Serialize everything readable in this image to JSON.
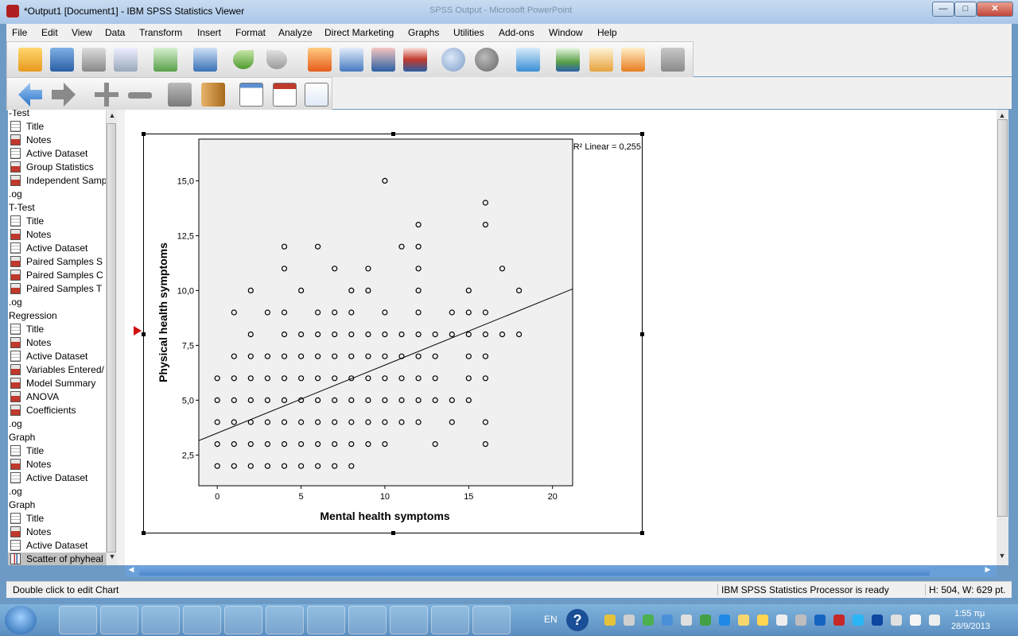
{
  "window": {
    "title": "*Output1 [Document1] - IBM SPSS Statistics Viewer",
    "background_title": "SPSS Output - Microsoft PowerPoint",
    "minimize": "—",
    "maximize": "□",
    "close": "✕"
  },
  "menu": [
    "File",
    "Edit",
    "View",
    "Data",
    "Transform",
    "Insert",
    "Format",
    "Analyze",
    "Direct Marketing",
    "Graphs",
    "Utilities",
    "Add-ons",
    "Window",
    "Help"
  ],
  "toolbar1": [
    "open-icon",
    "save-icon",
    "print-icon",
    "print-preview-icon",
    "export-icon",
    "recall-dialog-icon",
    "undo-icon",
    "redo-icon",
    "goto-data-icon",
    "goto-case-icon",
    "goto-variable-icon",
    "variables-icon",
    "spelling-icon",
    "designate-window-icon",
    "create-edit-icon",
    "show-all-variables-icon",
    "use-variable-sets-icon",
    "insert-output-icon",
    "run-script-icon",
    "disabled-icon"
  ],
  "toolbar2": [
    "back-arrow-icon",
    "forward-arrow-icon",
    "expand-icon",
    "collapse-icon",
    "show-icon",
    "hide-icon",
    "insert-heading-icon",
    "insert-title-icon",
    "insert-text-icon"
  ],
  "outline": [
    {
      "label": "-Test",
      "type": "heading"
    },
    {
      "label": "Title",
      "type": "item",
      "icon": "doc"
    },
    {
      "label": "Notes",
      "type": "item",
      "icon": "red"
    },
    {
      "label": "Active Dataset",
      "type": "item",
      "icon": "doc"
    },
    {
      "label": "Group Statistics",
      "type": "item",
      "icon": "red"
    },
    {
      "label": "Independent Samp",
      "type": "item",
      "icon": "red"
    },
    {
      "label": ".og",
      "type": "heading"
    },
    {
      "label": "T-Test",
      "type": "heading"
    },
    {
      "label": "Title",
      "type": "item",
      "icon": "doc"
    },
    {
      "label": "Notes",
      "type": "item",
      "icon": "red"
    },
    {
      "label": "Active Dataset",
      "type": "item",
      "icon": "doc"
    },
    {
      "label": "Paired Samples S",
      "type": "item",
      "icon": "red"
    },
    {
      "label": "Paired Samples C",
      "type": "item",
      "icon": "red"
    },
    {
      "label": "Paired Samples T",
      "type": "item",
      "icon": "red"
    },
    {
      "label": ".og",
      "type": "heading"
    },
    {
      "label": "Regression",
      "type": "heading"
    },
    {
      "label": "Title",
      "type": "item",
      "icon": "doc"
    },
    {
      "label": "Notes",
      "type": "item",
      "icon": "red"
    },
    {
      "label": "Active Dataset",
      "type": "item",
      "icon": "doc"
    },
    {
      "label": "Variables Entered/",
      "type": "item",
      "icon": "red"
    },
    {
      "label": "Model Summary",
      "type": "item",
      "icon": "red"
    },
    {
      "label": "ANOVA",
      "type": "item",
      "icon": "red"
    },
    {
      "label": "Coefficients",
      "type": "item",
      "icon": "red"
    },
    {
      "label": ".og",
      "type": "heading"
    },
    {
      "label": "Graph",
      "type": "heading"
    },
    {
      "label": "Title",
      "type": "item",
      "icon": "doc"
    },
    {
      "label": "Notes",
      "type": "item",
      "icon": "red"
    },
    {
      "label": "Active Dataset",
      "type": "item",
      "icon": "doc"
    },
    {
      "label": ".og",
      "type": "heading"
    },
    {
      "label": "Graph",
      "type": "heading"
    },
    {
      "label": "Title",
      "type": "item",
      "icon": "doc"
    },
    {
      "label": "Notes",
      "type": "item",
      "icon": "red"
    },
    {
      "label": "Active Dataset",
      "type": "item",
      "icon": "doc"
    },
    {
      "label": "Scatter of phyheal",
      "type": "item",
      "icon": "chart",
      "selected": true
    }
  ],
  "chart_data": {
    "type": "scatter",
    "xlabel": "Mental health symptoms",
    "ylabel": "Physical health symptoms",
    "xlim": [
      -1.1,
      21.2
    ],
    "ylim": [
      1.1,
      16.9
    ],
    "xticks": [
      0,
      5,
      10,
      15,
      20
    ],
    "xtick_labels": [
      "0",
      "5",
      "10",
      "15",
      "20"
    ],
    "yticks": [
      2.5,
      5.0,
      7.5,
      10.0,
      12.5,
      15.0
    ],
    "ytick_labels": [
      "2,5",
      "5,0",
      "7,5",
      "10,0",
      "12,5",
      "15,0"
    ],
    "r2_label": "R² Linear = 0,255",
    "fit_line": {
      "intercept": 3.5,
      "slope": 0.31
    },
    "points": [
      [
        0,
        2
      ],
      [
        1,
        2
      ],
      [
        2,
        2
      ],
      [
        3,
        2
      ],
      [
        4,
        2
      ],
      [
        5,
        2
      ],
      [
        6,
        2
      ],
      [
        7,
        2
      ],
      [
        8,
        2
      ],
      [
        0,
        3
      ],
      [
        1,
        3
      ],
      [
        2,
        3
      ],
      [
        3,
        3
      ],
      [
        4,
        3
      ],
      [
        5,
        3
      ],
      [
        6,
        3
      ],
      [
        7,
        3
      ],
      [
        8,
        3
      ],
      [
        9,
        3
      ],
      [
        10,
        3
      ],
      [
        13,
        3
      ],
      [
        16,
        3
      ],
      [
        0,
        4
      ],
      [
        1,
        4
      ],
      [
        2,
        4
      ],
      [
        3,
        4
      ],
      [
        4,
        4
      ],
      [
        5,
        4
      ],
      [
        6,
        4
      ],
      [
        7,
        4
      ],
      [
        8,
        4
      ],
      [
        9,
        4
      ],
      [
        10,
        4
      ],
      [
        11,
        4
      ],
      [
        12,
        4
      ],
      [
        14,
        4
      ],
      [
        16,
        4
      ],
      [
        0,
        5
      ],
      [
        1,
        5
      ],
      [
        2,
        5
      ],
      [
        3,
        5
      ],
      [
        4,
        5
      ],
      [
        5,
        5
      ],
      [
        6,
        5
      ],
      [
        7,
        5
      ],
      [
        8,
        5
      ],
      [
        9,
        5
      ],
      [
        10,
        5
      ],
      [
        11,
        5
      ],
      [
        12,
        5
      ],
      [
        13,
        5
      ],
      [
        14,
        5
      ],
      [
        15,
        5
      ],
      [
        0,
        6
      ],
      [
        1,
        6
      ],
      [
        2,
        6
      ],
      [
        3,
        6
      ],
      [
        4,
        6
      ],
      [
        5,
        6
      ],
      [
        6,
        6
      ],
      [
        7,
        6
      ],
      [
        8,
        6
      ],
      [
        9,
        6
      ],
      [
        10,
        6
      ],
      [
        11,
        6
      ],
      [
        12,
        6
      ],
      [
        13,
        6
      ],
      [
        15,
        6
      ],
      [
        16,
        6
      ],
      [
        1,
        7
      ],
      [
        2,
        7
      ],
      [
        3,
        7
      ],
      [
        4,
        7
      ],
      [
        5,
        7
      ],
      [
        6,
        7
      ],
      [
        7,
        7
      ],
      [
        8,
        7
      ],
      [
        9,
        7
      ],
      [
        10,
        7
      ],
      [
        11,
        7
      ],
      [
        12,
        7
      ],
      [
        13,
        7
      ],
      [
        15,
        7
      ],
      [
        16,
        7
      ],
      [
        2,
        8
      ],
      [
        4,
        8
      ],
      [
        5,
        8
      ],
      [
        6,
        8
      ],
      [
        7,
        8
      ],
      [
        8,
        8
      ],
      [
        9,
        8
      ],
      [
        10,
        8
      ],
      [
        11,
        8
      ],
      [
        12,
        8
      ],
      [
        13,
        8
      ],
      [
        14,
        8
      ],
      [
        15,
        8
      ],
      [
        16,
        8
      ],
      [
        17,
        8
      ],
      [
        18,
        8
      ],
      [
        1,
        9
      ],
      [
        3,
        9
      ],
      [
        4,
        9
      ],
      [
        6,
        9
      ],
      [
        7,
        9
      ],
      [
        8,
        9
      ],
      [
        10,
        9
      ],
      [
        12,
        9
      ],
      [
        14,
        9
      ],
      [
        15,
        9
      ],
      [
        16,
        9
      ],
      [
        2,
        10
      ],
      [
        5,
        10
      ],
      [
        8,
        10
      ],
      [
        9,
        10
      ],
      [
        12,
        10
      ],
      [
        15,
        10
      ],
      [
        18,
        10
      ],
      [
        4,
        11
      ],
      [
        7,
        11
      ],
      [
        9,
        11
      ],
      [
        12,
        11
      ],
      [
        17,
        11
      ],
      [
        4,
        12
      ],
      [
        6,
        12
      ],
      [
        11,
        12
      ],
      [
        12,
        12
      ],
      [
        12,
        13
      ],
      [
        16,
        13
      ],
      [
        16,
        14
      ],
      [
        10,
        15
      ]
    ]
  },
  "statusbar": {
    "hint": "Double click to edit Chart",
    "processor": "IBM SPSS Statistics Processor is ready",
    "size": "H: 504, W: 629 pt."
  },
  "taskbar": {
    "apps": [
      "windows-explorer-icon",
      "calculator-icon",
      "media-player-icon",
      "chrome-icon",
      "word-icon",
      "outlook-icon",
      "bpa-icon",
      "r-icon",
      "spss-icon",
      "acrobat-icon",
      "powerpoint-icon"
    ],
    "language": "EN",
    "time": "1:55 πμ",
    "date": "28/9/2013"
  }
}
